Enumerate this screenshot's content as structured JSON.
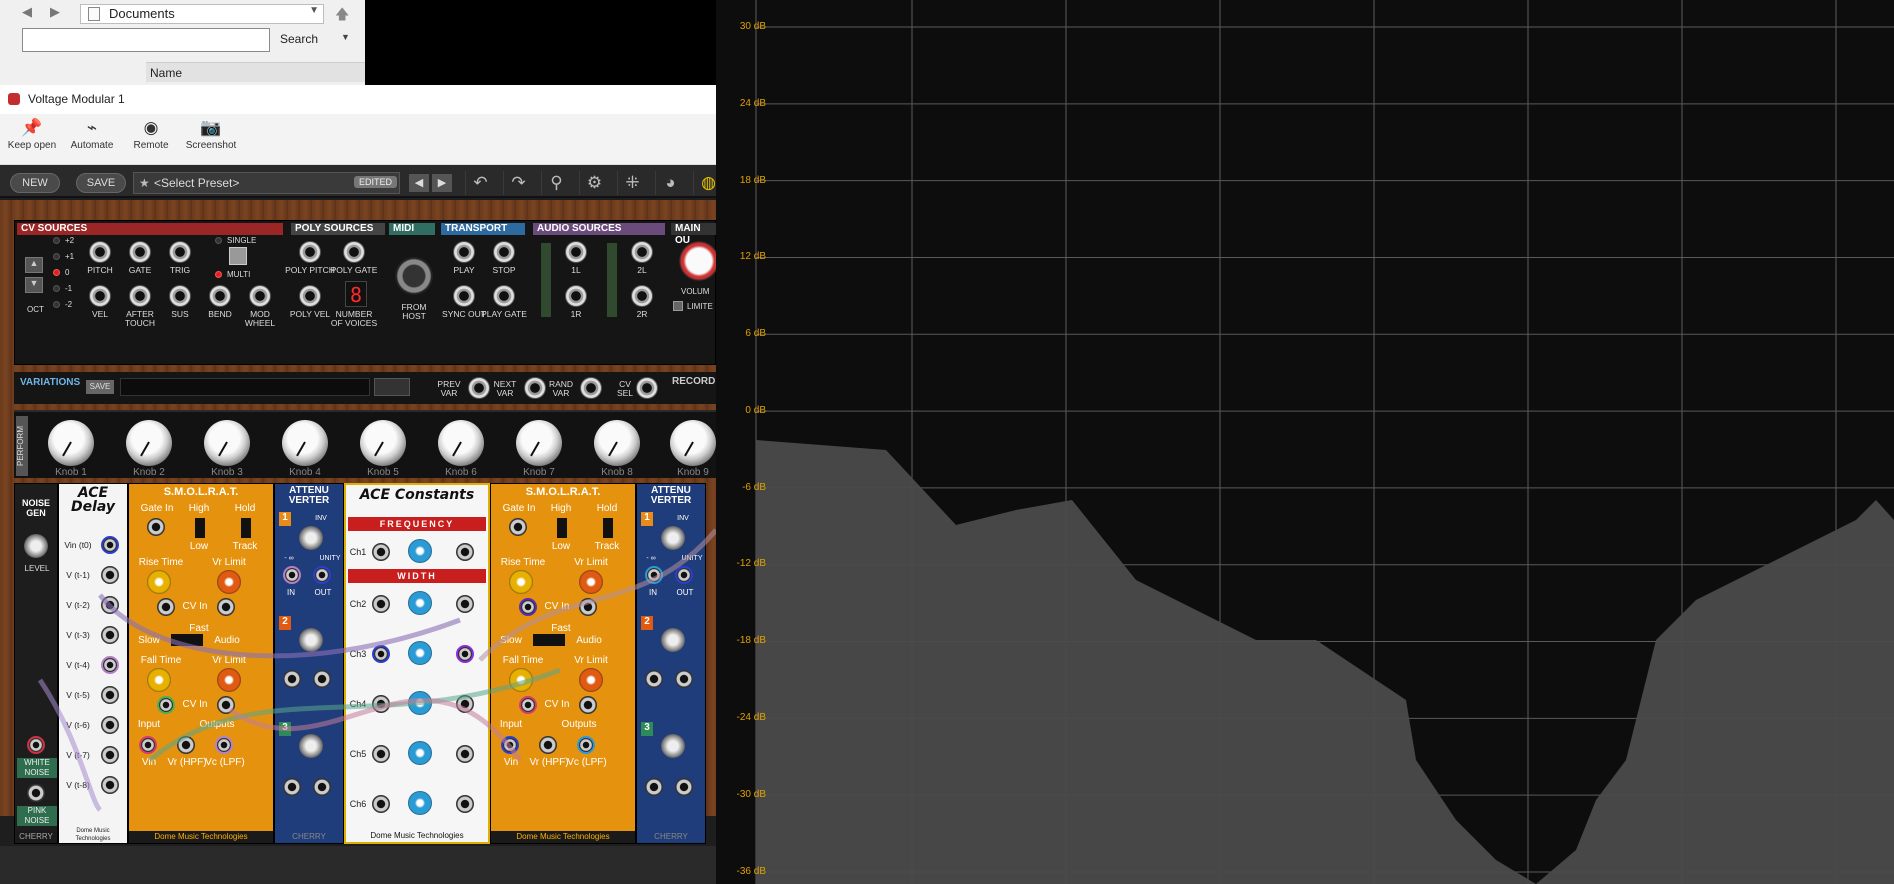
{
  "explorer": {
    "address": "Documents",
    "search_label": "Search",
    "name_header": "Name"
  },
  "window": {
    "title": "Voltage Modular 1",
    "toolbar": [
      {
        "label": "Keep open",
        "icon": "pin-icon"
      },
      {
        "label": "Automate",
        "icon": "automate-icon"
      },
      {
        "label": "Remote",
        "icon": "remote-icon"
      },
      {
        "label": "Screenshot",
        "icon": "camera-icon"
      }
    ]
  },
  "vm": {
    "new_label": "NEW",
    "save_label": "SAVE",
    "preset": "<Select Preset>",
    "edited": "EDITED"
  },
  "top_panel": {
    "cv_sources": "CV SOURCES",
    "poly_sources": "POLY SOURCES",
    "midi": "MIDI",
    "transport": "TRANSPORT",
    "audio_sources": "AUDIO SOURCES",
    "main_out": "MAIN OU",
    "oct_values": [
      "+2",
      "+1",
      "0",
      "-1",
      "-2"
    ],
    "oct_label": "OCT",
    "cv_labels_top": [
      "PITCH",
      "GATE",
      "TRIG"
    ],
    "cv_labels_bottom": [
      "VEL",
      "AFTER TOUCH",
      "SUS",
      "BEND",
      "MOD WHEEL"
    ],
    "single": "SINGLE",
    "multi": "MULTI",
    "poly_labels": [
      "POLY PITCH",
      "POLY GATE",
      "POLY VEL",
      "NUMBER OF VOICES"
    ],
    "voices": "8",
    "from_host": "FROM HOST",
    "transport_labels": [
      "PLAY",
      "STOP",
      "SYNC OUT",
      "PLAY GATE"
    ],
    "audio_labels": [
      "1L",
      "2L",
      "1R",
      "2R"
    ],
    "volume": "VOLUM",
    "limiter": "LIMITE"
  },
  "variations": {
    "label": "VARIATIONS",
    "save": "SAVE",
    "jacks": [
      "PREV VAR",
      "NEXT VAR",
      "RAND VAR",
      "CV SEL"
    ],
    "record": "RECORD"
  },
  "perform": {
    "label": "PERFORM",
    "knobs": [
      "Knob 1",
      "Knob 2",
      "Knob 3",
      "Knob 4",
      "Knob 5",
      "Knob 6",
      "Knob 7",
      "Knob 8",
      "Knob 9"
    ]
  },
  "modules": {
    "noise": {
      "title": "NOISE GEN",
      "level": "LEVEL",
      "white": "WHITE NOISE",
      "pink": "PINK NOISE",
      "footer": "CHERRY"
    },
    "delay": {
      "title": "ACE Delay",
      "rows": [
        "Vin (t0)",
        "V (t-1)",
        "V (t-2)",
        "V (t-3)",
        "V (t-4)",
        "V (t-5)",
        "V (t-6)",
        "V (t-7)",
        "V (t-8)"
      ],
      "footer": "Dome Music Technologies"
    },
    "smolrat": {
      "title": "S.M.O.L.R.A.T.",
      "gate_in": "Gate In",
      "high": "High",
      "low": "Low",
      "hold": "Hold",
      "track": "Track",
      "rise": "Rise Time",
      "vr_limit": "Vr Limit",
      "cv_in": "CV In",
      "fast": "Fast",
      "slow": "Slow",
      "audio": "Audio",
      "fall": "Fall Time",
      "input": "Input",
      "outputs": "Outputs",
      "vin": "Vin",
      "vr": "Vr (HPF)",
      "vc": "Vc (LPF)",
      "footer": "Dome Music Technologies"
    },
    "atten": {
      "title": "ATTENU VERTER",
      "inv": "INV",
      "minus_inf": "- ∞",
      "unity": "UNITY",
      "in": "IN",
      "out": "OUT",
      "footer": "CHERRY"
    },
    "constants": {
      "title": "ACE Constants",
      "frequency": "FREQUENCY",
      "width": "WIDTH",
      "channels": [
        "Ch1",
        "Ch2",
        "Ch3",
        "Ch4",
        "Ch5",
        "Ch6"
      ],
      "footer": "Dome Music Technologies"
    }
  },
  "spectrum": {
    "y_labels": [
      "30 dB",
      "24 dB",
      "18 dB",
      "12 dB",
      "6 dB",
      "0 dB",
      "-6 dB",
      "-12 dB",
      "-18 dB",
      "-24 dB",
      "-30 dB",
      "-36 dB"
    ],
    "accent": "#e0a000"
  }
}
